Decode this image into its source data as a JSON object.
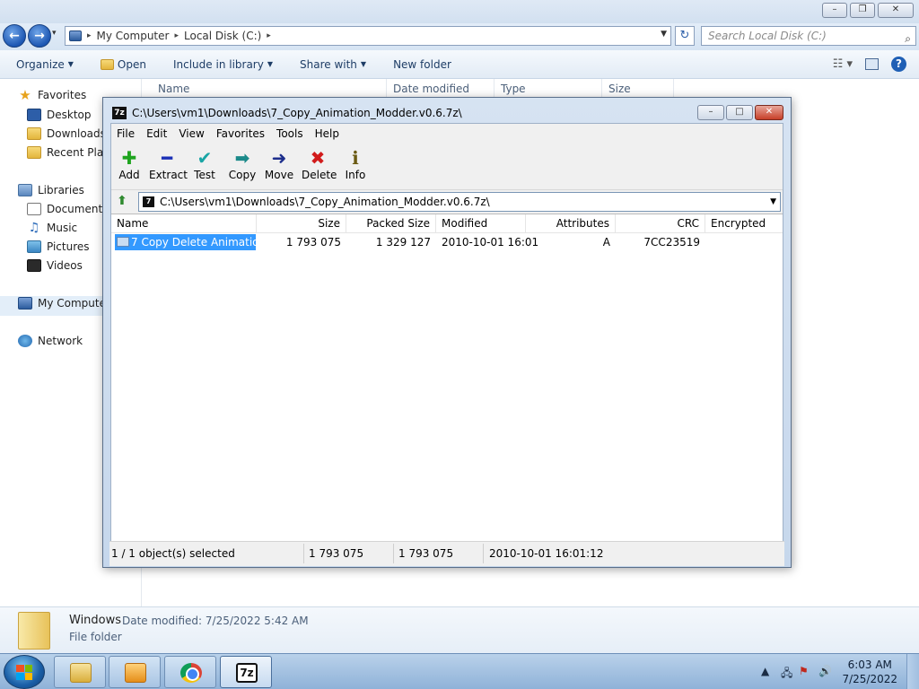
{
  "explorer": {
    "address": {
      "crumbs": [
        "My Computer",
        "Local Disk (C:)"
      ]
    },
    "search_placeholder": "Search Local Disk (C:)",
    "commands": [
      {
        "label": "Organize",
        "dropdown": true
      },
      {
        "label": "Open",
        "dropdown": false
      },
      {
        "label": "Include in library",
        "dropdown": true
      },
      {
        "label": "Share with",
        "dropdown": true
      },
      {
        "label": "New folder",
        "dropdown": false
      }
    ],
    "columns": [
      "Name",
      "Date modified",
      "Type",
      "Size"
    ],
    "nav": {
      "favorites": "Favorites",
      "desktop": "Desktop",
      "downloads": "Downloads",
      "recent": "Recent Places",
      "libraries": "Libraries",
      "documents": "Documents",
      "music": "Music",
      "pictures": "Pictures",
      "videos": "Videos",
      "computer": "My Computer",
      "network": "Network"
    },
    "details": {
      "name": "Windows",
      "modified_label": "Date modified:",
      "modified_value": "7/25/2022 5:42 AM",
      "type": "File folder"
    }
  },
  "zip": {
    "title": "C:\\Users\\vm1\\Downloads\\7_Copy_Animation_Modder.v0.6.7z\\",
    "menu": [
      "File",
      "Edit",
      "View",
      "Favorites",
      "Tools",
      "Help"
    ],
    "tools": [
      "Add",
      "Extract",
      "Test",
      "Copy",
      "Move",
      "Delete",
      "Info"
    ],
    "path": "C:\\Users\\vm1\\Downloads\\7_Copy_Animation_Modder.v0.6.7z\\",
    "columns": [
      "Name",
      "Size",
      "Packed Size",
      "Modified",
      "Attributes",
      "CRC",
      "Encrypted"
    ],
    "rows": [
      {
        "name": "7 Copy Delete Animatio...",
        "size": "1 793 075",
        "packed": "1 329 127",
        "modified": "2010-10-01 16:01",
        "attributes": "A",
        "crc": "7CC23519",
        "encrypted": ""
      }
    ],
    "status": {
      "selected": "1 / 1 object(s) selected",
      "size": "1 793 075",
      "packed": "1 793 075",
      "modified": "2010-10-01 16:01:12"
    }
  },
  "taskbar": {
    "time": "6:03 AM",
    "date": "7/25/2022"
  },
  "colors": {
    "selection": "#3399ff",
    "taskbar": "#a8c4e3"
  }
}
